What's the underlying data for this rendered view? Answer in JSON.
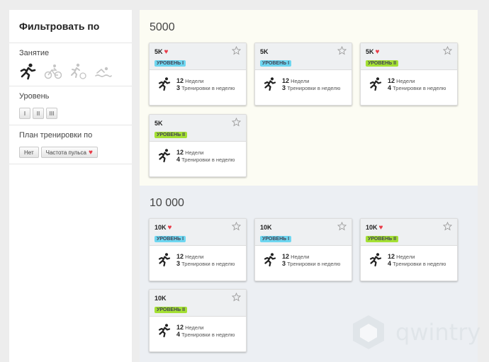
{
  "sidebar": {
    "title": "Фильтровать по",
    "activity_label": "Занятие",
    "activity_icons": [
      "running-icon",
      "cycling-icon",
      "triathlon-icon",
      "swimming-icon"
    ],
    "level_label": "Уровень",
    "levels": [
      "I",
      "II",
      "III"
    ],
    "plan_label": "План тренировки по",
    "plan_options": [
      "Нет",
      "Частота пульса"
    ]
  },
  "sections": [
    {
      "title": "5000",
      "cards": [
        {
          "title": "5K",
          "heart": true,
          "level": "УРОВЕНЬ I",
          "weeks": "12",
          "weeks_label": "Недели",
          "per_week": "3",
          "per_week_label": "Тренировки в неделю"
        },
        {
          "title": "5K",
          "heart": false,
          "level": "УРОВЕНЬ I",
          "weeks": "12",
          "weeks_label": "Недели",
          "per_week": "3",
          "per_week_label": "Тренировки в неделю"
        },
        {
          "title": "5K",
          "heart": true,
          "level": "УРОВЕНЬ II",
          "weeks": "12",
          "weeks_label": "Недели",
          "per_week": "4",
          "per_week_label": "Тренировки в неделю"
        },
        {
          "title": "5K",
          "heart": false,
          "level": "УРОВЕНЬ II",
          "weeks": "12",
          "weeks_label": "Недели",
          "per_week": "4",
          "per_week_label": "Тренировки в неделю"
        }
      ]
    },
    {
      "title": "10 000",
      "cards": [
        {
          "title": "10K",
          "heart": true,
          "level": "УРОВЕНЬ I",
          "weeks": "12",
          "weeks_label": "Недели",
          "per_week": "3",
          "per_week_label": "Тренировки в неделю"
        },
        {
          "title": "10K",
          "heart": false,
          "level": "УРОВЕНЬ I",
          "weeks": "12",
          "weeks_label": "Недели",
          "per_week": "3",
          "per_week_label": "Тренировки в неделю"
        },
        {
          "title": "10K",
          "heart": true,
          "level": "УРОВЕНЬ II",
          "weeks": "12",
          "weeks_label": "Недели",
          "per_week": "4",
          "per_week_label": "Тренировки в неделю"
        },
        {
          "title": "10K",
          "heart": false,
          "level": "УРОВЕНЬ II",
          "weeks": "12",
          "weeks_label": "Недели",
          "per_week": "4",
          "per_week_label": "Тренировки в неделю"
        }
      ]
    }
  ],
  "watermark": "qwintry",
  "colors": {
    "level1": "#6ed6f0",
    "level2": "#a4e034",
    "heart": "#e83a47"
  }
}
